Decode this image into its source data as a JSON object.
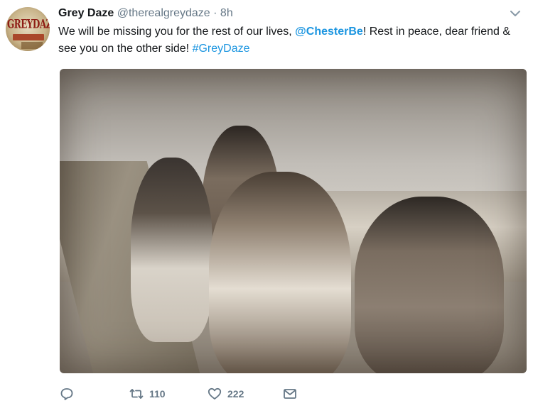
{
  "tweet": {
    "avatar": {
      "logo_text": "GREYDAZE"
    },
    "author_name": "Grey Daze",
    "handle": "@therealgreydaze",
    "separator": " · ",
    "time": "8h",
    "text_before": "We will be missing you for the rest of our lives, ",
    "mention": "@ChesterBe",
    "text_middle": "! Rest in peace, dear friend & see you on the other side! ",
    "hashtag": "#GreyDaze"
  },
  "actions": {
    "reply_icon": "reply-icon",
    "retweet_icon": "retweet-icon",
    "retweet_count": "110",
    "like_icon": "heart-icon",
    "like_count": "222",
    "dm_icon": "mail-icon"
  },
  "colors": {
    "link": "#1b95e0",
    "text": "#14171a",
    "muted": "#657786"
  }
}
